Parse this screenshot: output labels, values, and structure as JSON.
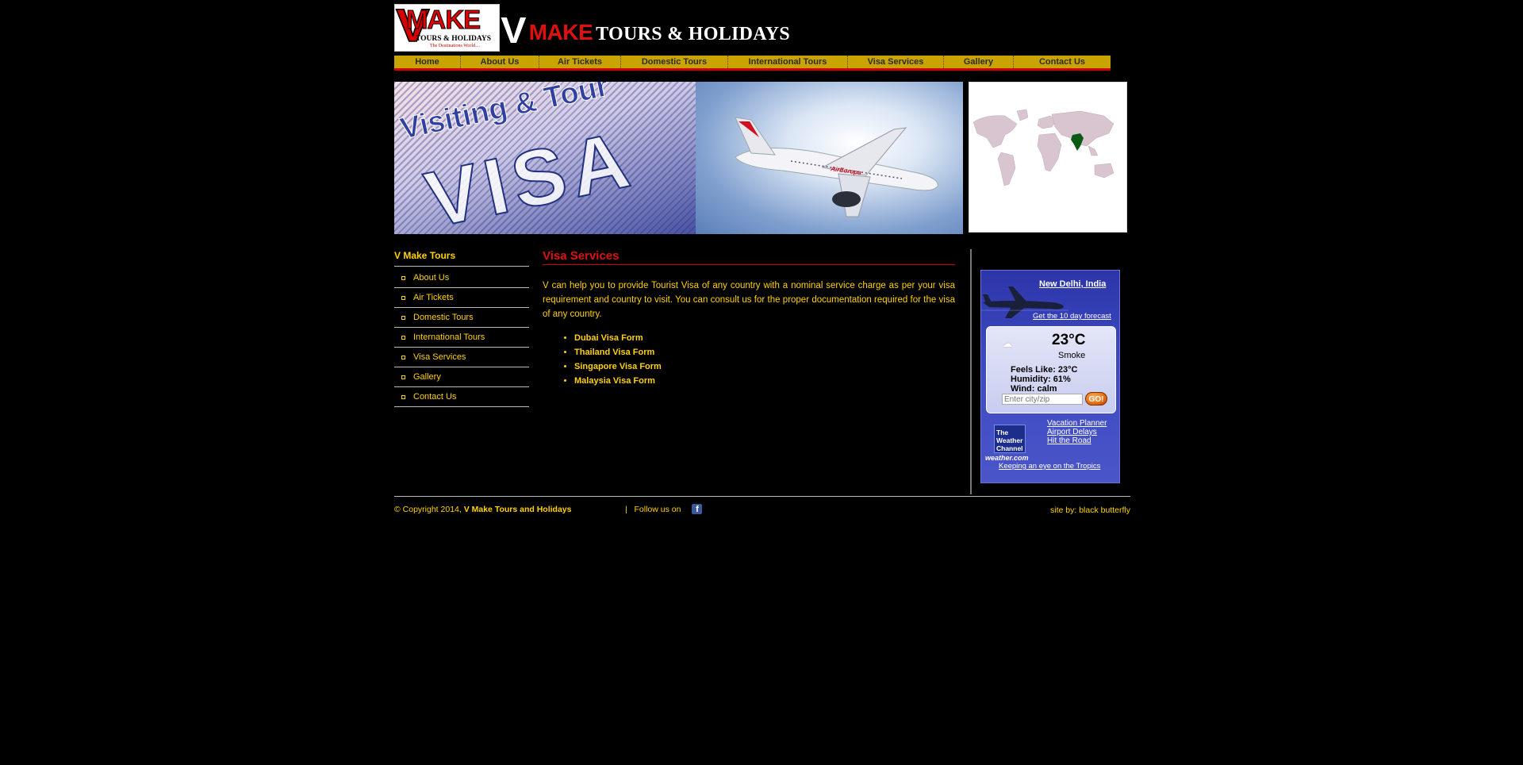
{
  "header": {
    "logo_letter": "V",
    "logo_make": "MAKE",
    "logo_sub": "TOURS & HOLIDAYS",
    "logo_tagline": "The Destinations World....",
    "brand_v": "V",
    "brand_make": "MAKE",
    "brand_rest": "TOURS & HOLIDAYS"
  },
  "nav": {
    "items": [
      "Home",
      "About Us",
      "Air Tickets",
      "Domestic Tours",
      "International Tours",
      "Visa Services",
      "Gallery",
      "Contact Us"
    ]
  },
  "banner": {
    "headline": "Visiting & Tour",
    "visa_word": "VISA"
  },
  "sidebar": {
    "title": "V Make Tours",
    "items": [
      "About Us",
      "Air Tickets",
      "Domestic Tours",
      "International Tours",
      "Visa Services",
      "Gallery",
      "Contact Us"
    ]
  },
  "content": {
    "title": "Visa Services",
    "text": "V can help you to provide Tourist Visa of any country with a nominal service charge as per your visa requirement and country to visit. You can consult us for the proper documentation required for the visa of any country.",
    "forms": [
      "Dubai Visa Form",
      "Thailand Visa Form",
      "Singapore Visa Form",
      "Malaysia Visa Form"
    ]
  },
  "weather": {
    "city": "New Delhi, India",
    "forecast_link": "Get the 10 day forecast",
    "temp": "23°C",
    "condition": "Smoke",
    "feels_like": "Feels Like: 23°C",
    "humidity": "Humidity: 61%",
    "wind": "Wind: calm",
    "input_placeholder": "Enter city/zip",
    "go_label": "GO!",
    "twc_label": "The Weather Channel",
    "weather_com": "weather.com",
    "links": [
      "Vacation Planner",
      "Airport Delays",
      "Hit the Road"
    ],
    "tropics_link": "Keeping an eye on the Tropics"
  },
  "footer": {
    "copyright": "© Copyright 2014, ",
    "company": "V Make Tours and Holidays",
    "follow": "|   Follow us on",
    "fb": "f",
    "credit": "site by: black butterfly"
  },
  "colors": {
    "background": "#000000",
    "accent_yellow": "#ffd200",
    "nav_gold": "#c9a400",
    "brand_red": "#e01010"
  }
}
